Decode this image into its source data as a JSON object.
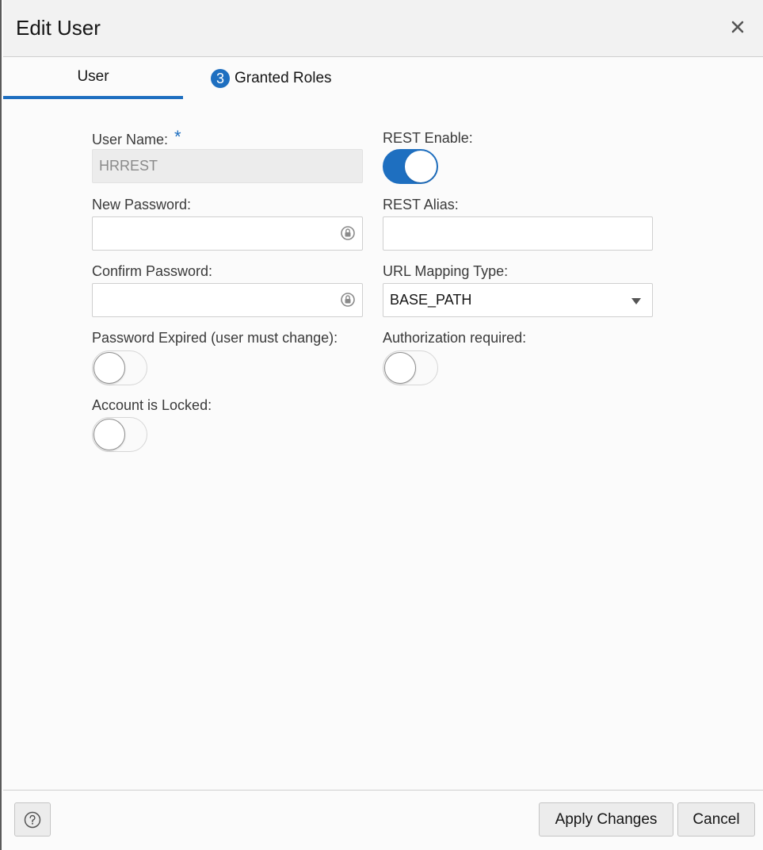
{
  "dialog": {
    "title": "Edit User",
    "close_icon": "close-icon"
  },
  "tabs": [
    {
      "label": "User",
      "active": true
    },
    {
      "label": "Granted Roles",
      "badge": "3",
      "active": false
    }
  ],
  "form": {
    "user_name": {
      "label": "User Name:",
      "required_mark": "*",
      "value": "HRREST",
      "disabled": true
    },
    "new_password": {
      "label": "New Password:",
      "value": ""
    },
    "confirm_password": {
      "label": "Confirm Password:",
      "value": ""
    },
    "password_expired": {
      "label": "Password Expired (user must change):",
      "on": false
    },
    "account_locked": {
      "label": "Account is Locked:",
      "on": false
    },
    "rest_enable": {
      "label": "REST Enable:",
      "on": true
    },
    "rest_alias": {
      "label": "REST Alias:",
      "value": ""
    },
    "url_mapping_type": {
      "label": "URL Mapping Type:",
      "value": "BASE_PATH"
    },
    "authorization_required": {
      "label": "Authorization required:",
      "on": false
    }
  },
  "footer": {
    "help_icon": "help-icon",
    "apply_label": "Apply Changes",
    "cancel_label": "Cancel"
  },
  "colors": {
    "accent": "#1e6fc0",
    "header_bg": "#f2f2f2",
    "button_bg": "#ececec"
  }
}
